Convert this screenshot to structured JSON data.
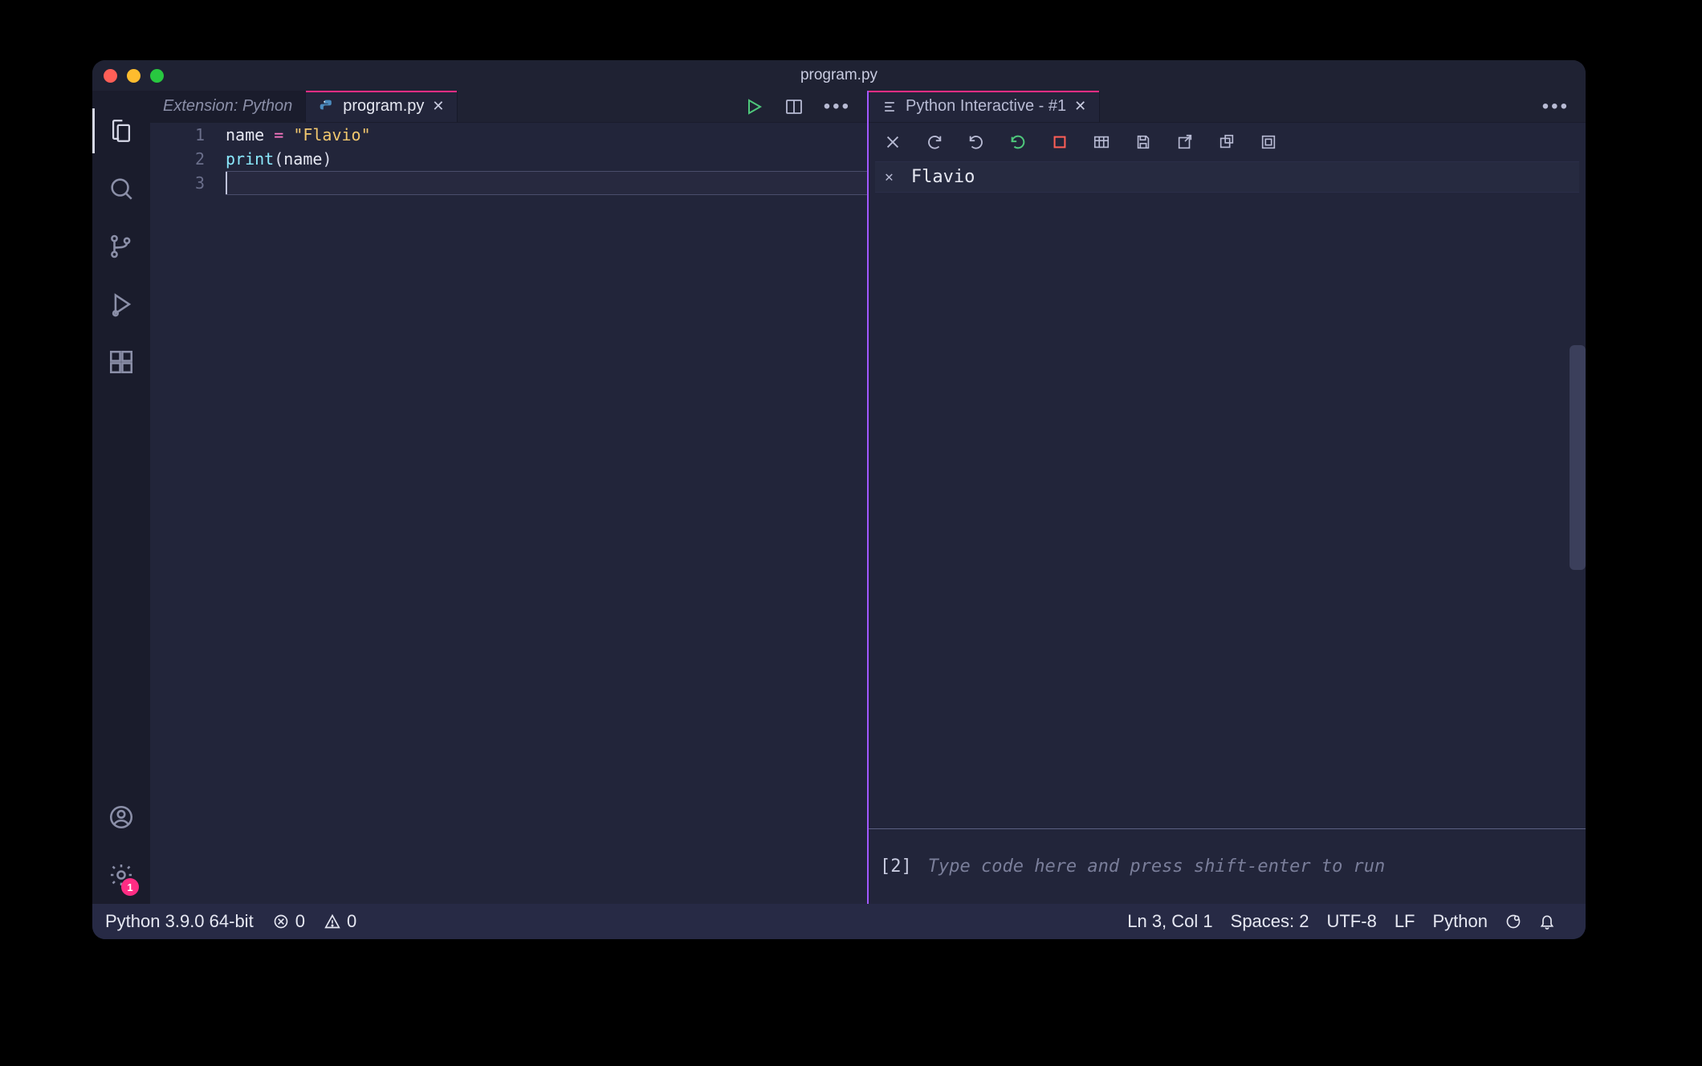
{
  "window": {
    "title": "program.py"
  },
  "activitybar": {
    "items": [
      "explorer",
      "search",
      "scm",
      "debug",
      "extensions"
    ],
    "bottom": [
      "accounts",
      "settings"
    ],
    "settings_badge": "1"
  },
  "tabs_left": {
    "ext_tab": "Extension: Python",
    "file_tab": "program.py"
  },
  "tabs_right": {
    "title": "Python Interactive - #1"
  },
  "code": {
    "lines": [
      {
        "n": "1",
        "tokens": [
          [
            "id",
            "name"
          ],
          [
            "sp",
            " "
          ],
          [
            "eq",
            "="
          ],
          [
            "sp",
            " "
          ],
          [
            "str",
            "\"Flavio\""
          ]
        ]
      },
      {
        "n": "2",
        "tokens": [
          [
            "fn",
            "print"
          ],
          [
            "par",
            "("
          ],
          [
            "id",
            "name"
          ],
          [
            "par",
            ")"
          ]
        ]
      },
      {
        "n": "3",
        "tokens": []
      }
    ],
    "cursor_line": 3
  },
  "interactive": {
    "output": "Flavio",
    "input_index": "[2]",
    "placeholder": "Type code here and press shift-enter to run"
  },
  "statusbar": {
    "python": "Python 3.9.0 64-bit",
    "errors": "0",
    "warnings": "0",
    "ln_col": "Ln 3, Col 1",
    "spaces": "Spaces: 2",
    "encoding": "UTF-8",
    "eol": "LF",
    "language": "Python"
  }
}
